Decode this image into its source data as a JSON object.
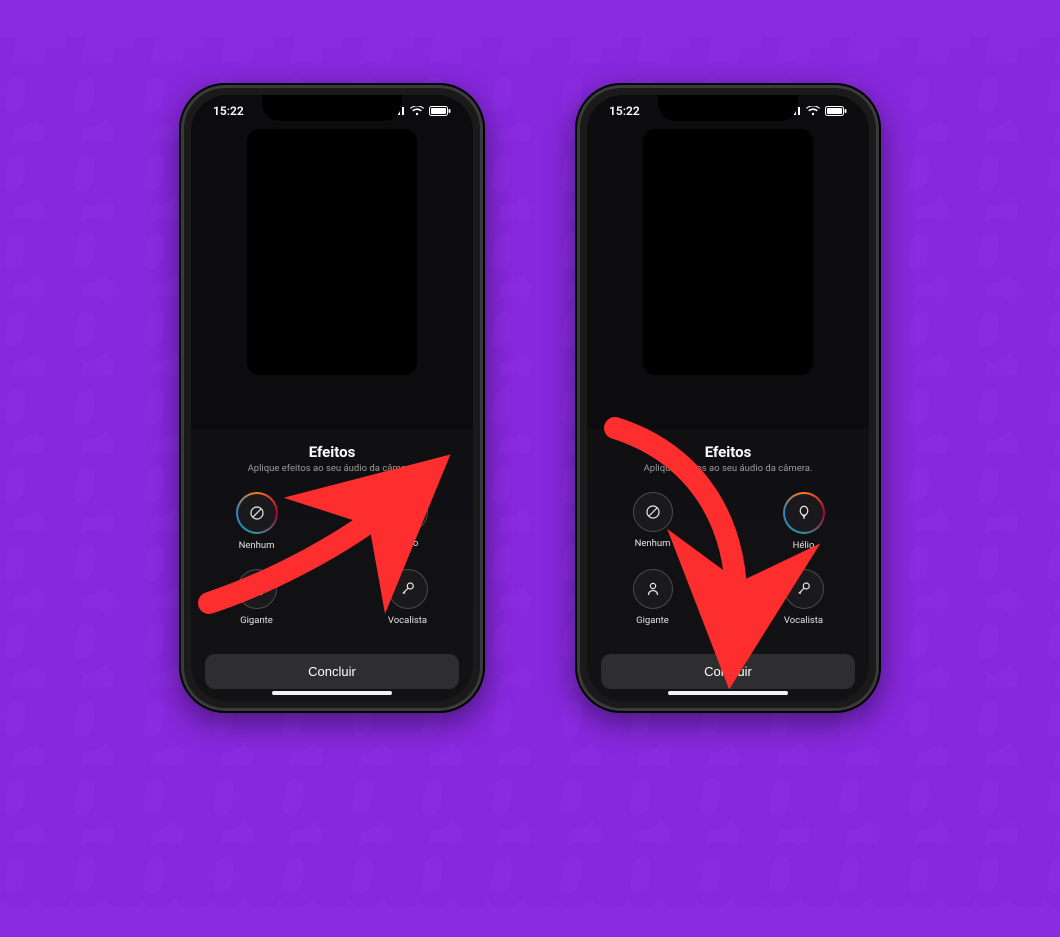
{
  "background": {
    "pattern_text": "tbtbtbtbtbtbtbtbtbtbtbtb"
  },
  "statusbar": {
    "time": "15:22"
  },
  "panel": {
    "title": "Efeitos",
    "subtitle": "Aplique efeitos ao seu áudio da câmera."
  },
  "effects": {
    "none": {
      "label": "Nenhum",
      "icon": "none-icon"
    },
    "helio": {
      "label": "Hélio",
      "icon": "balloon-icon"
    },
    "giant": {
      "label": "Gigante",
      "icon": "giant-icon"
    },
    "vocal": {
      "label": "Vocalista",
      "icon": "mic-icon"
    }
  },
  "left_phone": {
    "selected_effect": "none"
  },
  "right_phone": {
    "selected_effect": "helio"
  },
  "done_button": {
    "label": "Concluir"
  },
  "annotation_arrows": {
    "left": {
      "target": "helio-effect",
      "color": "#ff2e2e"
    },
    "right": {
      "target": "concluir-button",
      "color": "#ff2e2e"
    }
  }
}
